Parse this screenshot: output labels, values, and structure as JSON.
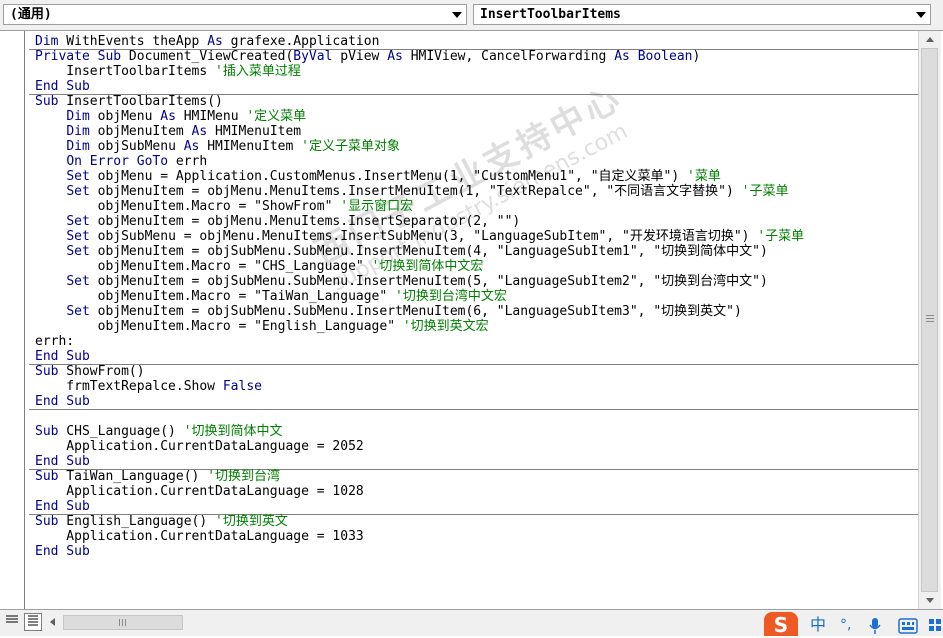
{
  "object_combo": {
    "value": "(通用)"
  },
  "procedure_combo": {
    "value": "InsertToolbarItems"
  },
  "watermark": {
    "line1": "西门子工业支持中心",
    "line2": "support.industry.siemens.com"
  },
  "ime": {
    "logo": "S",
    "mode": "中"
  },
  "code": [
    {
      "tokens": [
        {
          "t": "Dim",
          "c": "kw"
        },
        {
          "t": " WithEvents theApp "
        },
        {
          "t": "As",
          "c": "kw"
        },
        {
          "t": " grafexe.Application"
        }
      ],
      "sep_after": true
    },
    {
      "tokens": [
        {
          "t": "Private Sub",
          "c": "kw"
        },
        {
          "t": " Document_ViewCreated("
        },
        {
          "t": "ByVal",
          "c": "kw"
        },
        {
          "t": " pView "
        },
        {
          "t": "As",
          "c": "kw"
        },
        {
          "t": " HMIView, CancelForwarding "
        },
        {
          "t": "As",
          "c": "kw"
        },
        {
          "t": " "
        },
        {
          "t": "Boolean",
          "c": "kw"
        },
        {
          "t": ")"
        }
      ]
    },
    {
      "tokens": [
        {
          "t": "    InsertToolbarItems "
        },
        {
          "t": "'插入菜单过程",
          "c": "cm"
        }
      ]
    },
    {
      "tokens": [
        {
          "t": "End Sub",
          "c": "kw"
        }
      ],
      "sep_after": true
    },
    {
      "tokens": [
        {
          "t": "Sub",
          "c": "kw"
        },
        {
          "t": " InsertToolbarItems()"
        }
      ]
    },
    {
      "tokens": [
        {
          "t": "    "
        },
        {
          "t": "Dim",
          "c": "kw"
        },
        {
          "t": " objMenu "
        },
        {
          "t": "As",
          "c": "kw"
        },
        {
          "t": " HMIMenu "
        },
        {
          "t": "'定义菜单",
          "c": "cm"
        }
      ]
    },
    {
      "tokens": [
        {
          "t": "    "
        },
        {
          "t": "Dim",
          "c": "kw"
        },
        {
          "t": " objMenuItem "
        },
        {
          "t": "As",
          "c": "kw"
        },
        {
          "t": " HMIMenuItem"
        }
      ]
    },
    {
      "tokens": [
        {
          "t": "    "
        },
        {
          "t": "Dim",
          "c": "kw"
        },
        {
          "t": " objSubMenu "
        },
        {
          "t": "As",
          "c": "kw"
        },
        {
          "t": " HMIMenuItem "
        },
        {
          "t": "'定义子菜单对象",
          "c": "cm"
        }
      ]
    },
    {
      "tokens": [
        {
          "t": "    "
        },
        {
          "t": "On Error GoTo",
          "c": "kw"
        },
        {
          "t": " errh"
        }
      ]
    },
    {
      "tokens": [
        {
          "t": "    "
        },
        {
          "t": "Set",
          "c": "kw"
        },
        {
          "t": " objMenu = Application.CustomMenus.InsertMenu(1, \"CustomMenu1\", \"自定义菜单\") "
        },
        {
          "t": "'菜单",
          "c": "cm"
        }
      ]
    },
    {
      "tokens": [
        {
          "t": "    "
        },
        {
          "t": "Set",
          "c": "kw"
        },
        {
          "t": " objMenuItem = objMenu.MenuItems.InsertMenuItem(1, \"TextRepalce\", \"不同语言文字替换\") "
        },
        {
          "t": "'子菜单",
          "c": "cm"
        }
      ]
    },
    {
      "tokens": [
        {
          "t": "        objMenuItem.Macro = \"ShowFrom\" "
        },
        {
          "t": "'显示窗口宏",
          "c": "cm"
        }
      ]
    },
    {
      "tokens": [
        {
          "t": "    "
        },
        {
          "t": "Set",
          "c": "kw"
        },
        {
          "t": " objMenuItem = objMenu.MenuItems.InsertSeparator(2, \"\")"
        }
      ]
    },
    {
      "tokens": [
        {
          "t": "    "
        },
        {
          "t": "Set",
          "c": "kw"
        },
        {
          "t": " objSubMenu = objMenu.MenuItems.InsertSubMenu(3, \"LanguageSubItem\", \"开发环境语言切换\") "
        },
        {
          "t": "'子菜单",
          "c": "cm"
        }
      ]
    },
    {
      "tokens": [
        {
          "t": "    "
        },
        {
          "t": "Set",
          "c": "kw"
        },
        {
          "t": " objMenuItem = objSubMenu.SubMenu.InsertMenuItem(4, \"LanguageSubItem1\", \"切换到简体中文\")"
        }
      ]
    },
    {
      "tokens": [
        {
          "t": "        objMenuItem.Macro = \"CHS_Language\" "
        },
        {
          "t": "'切换到简体中文宏",
          "c": "cm"
        }
      ]
    },
    {
      "tokens": [
        {
          "t": "    "
        },
        {
          "t": "Set",
          "c": "kw"
        },
        {
          "t": " objMenuItem = objSubMenu.SubMenu.InsertMenuItem(5, \"LanguageSubItem2\", \"切换到台湾中文\")"
        }
      ]
    },
    {
      "tokens": [
        {
          "t": "        objMenuItem.Macro = \"TaiWan_Language\" "
        },
        {
          "t": "'切换到台湾中文宏",
          "c": "cm"
        }
      ]
    },
    {
      "tokens": [
        {
          "t": "    "
        },
        {
          "t": "Set",
          "c": "kw"
        },
        {
          "t": " objMenuItem = objSubMenu.SubMenu.InsertMenuItem(6, \"LanguageSubItem3\", \"切换到英文\")"
        }
      ]
    },
    {
      "tokens": [
        {
          "t": "        objMenuItem.Macro = \"English_Language\" "
        },
        {
          "t": "'切换到英文宏",
          "c": "cm"
        }
      ]
    },
    {
      "tokens": [
        {
          "t": "errh:"
        }
      ]
    },
    {
      "tokens": [
        {
          "t": "End Sub",
          "c": "kw"
        }
      ],
      "sep_after": true
    },
    {
      "tokens": [
        {
          "t": "Sub",
          "c": "kw"
        },
        {
          "t": " ShowFrom()"
        }
      ]
    },
    {
      "tokens": [
        {
          "t": "    frmTextRepalce.Show "
        },
        {
          "t": "False",
          "c": "kw"
        }
      ]
    },
    {
      "tokens": [
        {
          "t": "End Sub",
          "c": "kw"
        }
      ],
      "sep_after": true
    },
    {
      "tokens": [
        {
          "t": ""
        }
      ]
    },
    {
      "tokens": [
        {
          "t": "Sub",
          "c": "kw"
        },
        {
          "t": " CHS_Language() "
        },
        {
          "t": "'切换到简体中文",
          "c": "cm"
        }
      ]
    },
    {
      "tokens": [
        {
          "t": "    Application.CurrentDataLanguage = 2052"
        }
      ]
    },
    {
      "tokens": [
        {
          "t": "End Sub",
          "c": "kw"
        }
      ],
      "sep_after": true
    },
    {
      "tokens": [
        {
          "t": "Sub",
          "c": "kw"
        },
        {
          "t": " TaiWan_Language() "
        },
        {
          "t": "'切换到台湾",
          "c": "cm"
        }
      ]
    },
    {
      "tokens": [
        {
          "t": "    Application.CurrentDataLanguage = 1028"
        }
      ]
    },
    {
      "tokens": [
        {
          "t": "End Sub",
          "c": "kw"
        }
      ],
      "sep_after": true
    },
    {
      "tokens": [
        {
          "t": "Sub",
          "c": "kw"
        },
        {
          "t": " English_Language() "
        },
        {
          "t": "'切换到英文",
          "c": "cm"
        }
      ]
    },
    {
      "tokens": [
        {
          "t": "    Application.CurrentDataLanguage = 1033"
        }
      ]
    },
    {
      "tokens": [
        {
          "t": "End Sub",
          "c": "kw"
        }
      ]
    }
  ]
}
